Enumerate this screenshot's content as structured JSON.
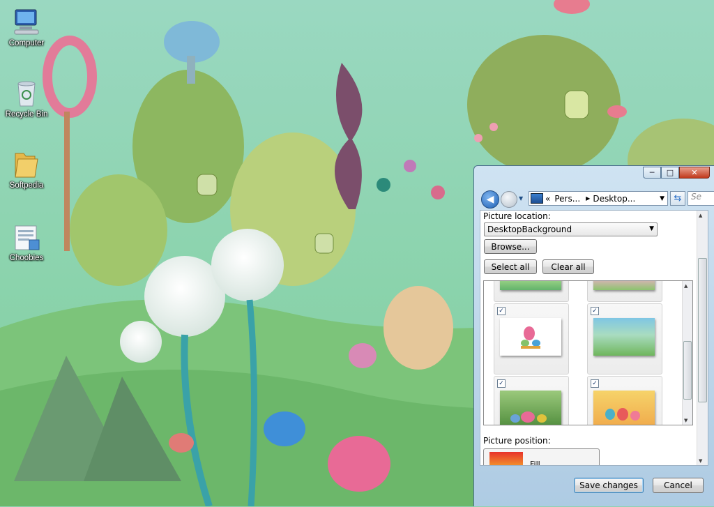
{
  "desktop": {
    "icons": [
      {
        "label": "Computer",
        "icon": "computer-icon"
      },
      {
        "label": "Recycle Bin",
        "icon": "recycle-bin-icon"
      },
      {
        "label": "Softpedia",
        "icon": "folder-icon"
      },
      {
        "label": "Choobies",
        "icon": "document-icon"
      }
    ]
  },
  "window": {
    "caption": {
      "minimize": "─",
      "maximize": "□",
      "close": "✕"
    },
    "nav": {
      "address_prefix": "«",
      "crumb1": "Pers...",
      "crumb2": "Desktop...",
      "search_placeholder": "Se"
    },
    "picture_location_label": "Picture location:",
    "picture_location_value": "DesktopBackground",
    "browse_label": "Browse...",
    "select_all_label": "Select all",
    "clear_all_label": "Clear all",
    "picture_position_label": "Picture position:",
    "picture_position_value": "Fill",
    "save_label": "Save changes",
    "cancel_label": "Cancel",
    "thumbnails": [
      {
        "checked": true,
        "mark": "✓"
      },
      {
        "checked": true,
        "mark": "✓"
      },
      {
        "checked": true,
        "mark": "✓"
      },
      {
        "checked": true,
        "mark": "✓"
      }
    ]
  }
}
